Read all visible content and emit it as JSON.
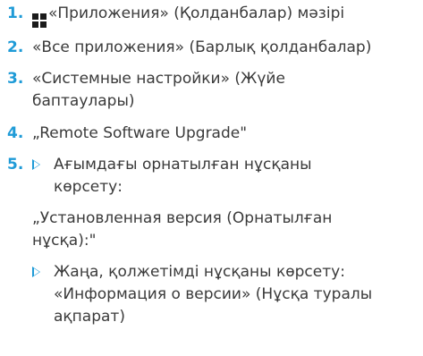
{
  "items": [
    {
      "number": "1.",
      "icon": "grid-menu-icon",
      "text": "«Приложения» (Қолданбалар) мәзірі"
    },
    {
      "number": "2.",
      "text": "«Все приложения» (Барлық қолданбалар)"
    },
    {
      "number": "3.",
      "text": "«Системные настройки» (Жүйе баптаулары)"
    },
    {
      "number": "4.",
      "text": "„Remote Software Upgrade\""
    },
    {
      "number": "5.",
      "sub1": "Ағымдағы орнатылған нұсқаны көрсету:",
      "quote": "„Установленная версия (Орнатылған нұсқа):\"",
      "sub2": "Жаңа, қолжетімді нұсқаны көрсету: «Информация о версии» (Нұсқа туралы ақпарат)"
    }
  ],
  "colors": {
    "accent": "#1f9bd7",
    "text": "#3a3a3a"
  }
}
